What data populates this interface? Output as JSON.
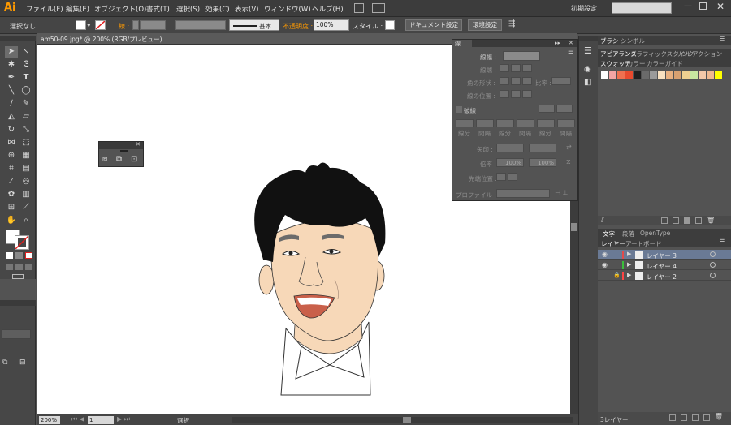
{
  "app": {
    "logo": "Ai"
  },
  "menu": [
    "ファイル(F)",
    "編集(E)",
    "オブジェクト(O)",
    "書式(T)",
    "選択(S)",
    "効果(C)",
    "表示(V)",
    "ウィンドウ(W)",
    "ヘルプ(H)"
  ],
  "workspace": {
    "label": "初期設定",
    "search_placeholder": ""
  },
  "control": {
    "selection": "選択なし",
    "stroke_label": "線 :",
    "brush": "基本",
    "opacity_label": "不透明度 :",
    "opacity_value": "100%",
    "style_label": "スタイル :",
    "doc_settings": "ドキュメント設定",
    "env_settings": "環境設定"
  },
  "document": {
    "tab": "am50-09.jpg* @ 200% (RGB/プレビュー)",
    "zoom": "200%",
    "page": "1",
    "status": "選択"
  },
  "stroke_panel": {
    "title": "線",
    "weight_label": "線幅 :",
    "cap_label": "線端 :",
    "corner_label": "角の形状 :",
    "limit_label": "比率 :",
    "align_label": "線の位置 :",
    "dashed_label": "破線",
    "dash_labels": [
      "線分",
      "間隔",
      "線分",
      "間隔",
      "線分",
      "間隔"
    ],
    "arrow_label": "矢印 :",
    "scale_label": "倍率 :",
    "scale_value1": "100%",
    "scale_value2": "100%",
    "align_arrow_label": "先端位置 :",
    "profile_label": "プロファイル :"
  },
  "right_panel": {
    "top_tabs": [
      "ブラシ",
      "シンボル"
    ],
    "second_tabs": [
      "アピアランス",
      "グラフィックスタイル",
      "リンク",
      "アクション"
    ],
    "third_tabs": [
      "スウォッチ",
      "カラー",
      "カラーガイド"
    ],
    "swatch_colors": [
      "#ffffff",
      "#f4a4a4",
      "#f07050",
      "#e84a2e",
      "#202020",
      "#6a6a6a",
      "#9a9a9a",
      "#f8e0c0",
      "#e8b080",
      "#d8a070",
      "#f0d090",
      "#c8e8a0",
      "#f4c8a8",
      "#f0b890",
      "#ffff00"
    ],
    "type_tabs": [
      "文字",
      "段落",
      "OpenType"
    ],
    "layer_tabs": [
      "レイヤー",
      "アートボード"
    ],
    "layers": [
      {
        "name": "レイヤー 3",
        "color": "#e24a4a",
        "selected": true
      },
      {
        "name": "レイヤー 4",
        "color": "#3bbf3b",
        "selected": false
      },
      {
        "name": "レイヤー 2",
        "color": "#ff4444",
        "selected": false
      }
    ],
    "layer_count": "3レイヤー"
  },
  "colors": {
    "accent_orange": "#ff9a00",
    "layer_selected": "#6a7a95"
  }
}
